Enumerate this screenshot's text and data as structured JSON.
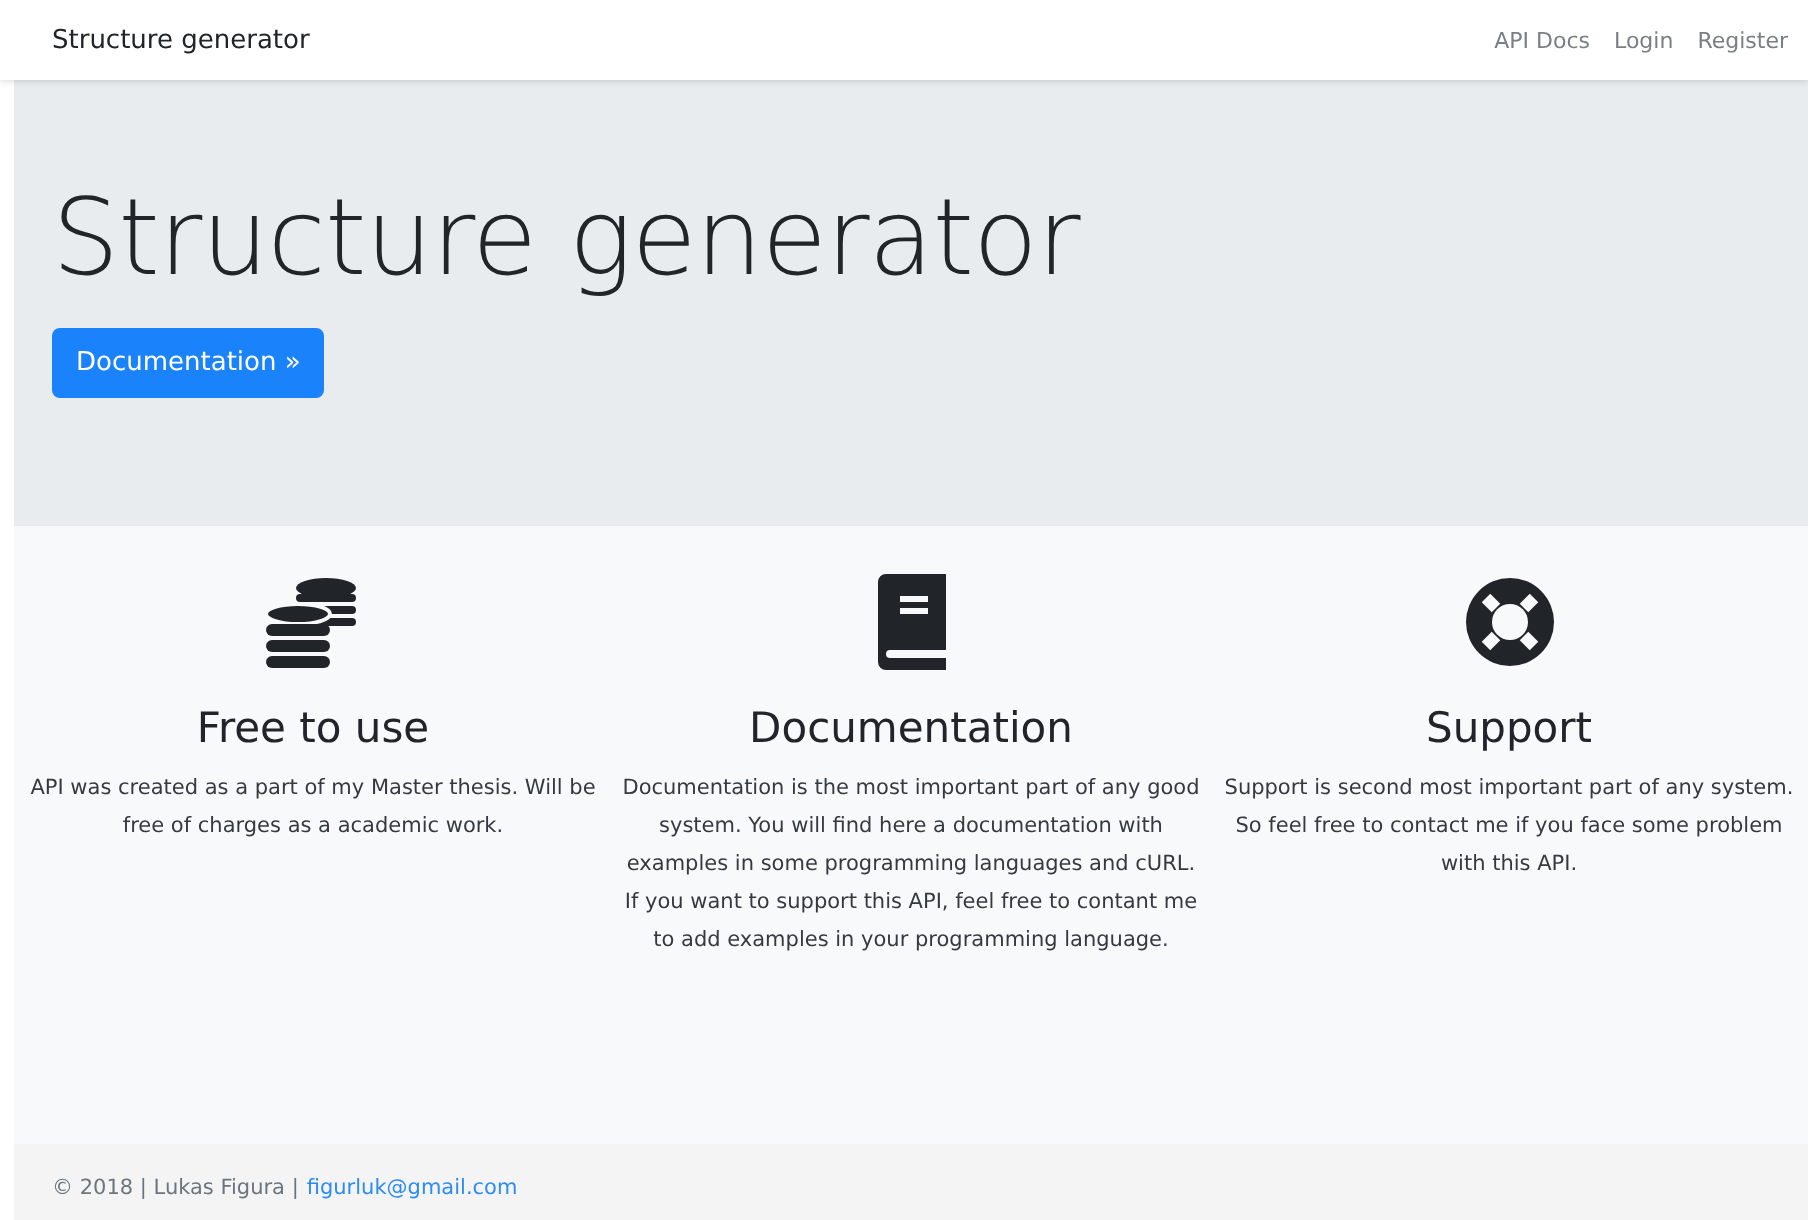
{
  "navbar": {
    "brand": "Structure generator",
    "links": [
      "API Docs",
      "Login",
      "Register"
    ]
  },
  "hero": {
    "title": "Structure generator",
    "button": "Documentation »"
  },
  "features": [
    {
      "kind": "coins",
      "title": "Free to use",
      "text": "API was created as a part of my Master thesis. Will be free of charges as a academic work."
    },
    {
      "kind": "book",
      "title": "Documentation",
      "text": "Documentation is the most important part of any good system. You will find here a documentation with examples in some programming languages and cURL. If you want to support this API, feel free to contant me to add examples in your programming language."
    },
    {
      "kind": "lifering",
      "title": "Support",
      "text": "Support is second most important part of any system. So feel free to contact me if you face some problem with this API."
    }
  ],
  "footer": {
    "text": "© 2018 | Lukas Figura |",
    "email": "figurluk@gmail.com"
  }
}
